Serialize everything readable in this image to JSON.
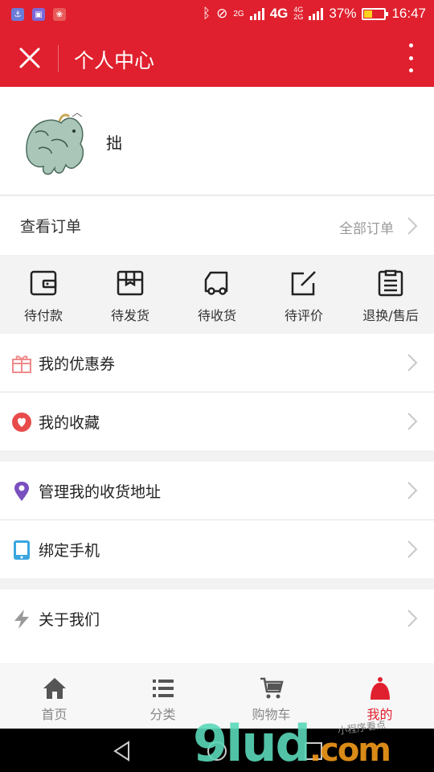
{
  "status_bar": {
    "network_top": "2G",
    "network_main": "4G",
    "network_second": "4G",
    "network_second_sub": "2G",
    "battery": "37%",
    "battery_level": 0.37,
    "time": "16:47"
  },
  "header": {
    "title": "个人中心"
  },
  "profile": {
    "username": "拙"
  },
  "orders": {
    "title": "查看订单",
    "all_label": "全部订单"
  },
  "order_status": [
    {
      "label": "待付款",
      "icon": "wallet-icon"
    },
    {
      "label": "待发货",
      "icon": "box-icon"
    },
    {
      "label": "待收货",
      "icon": "truck-icon"
    },
    {
      "label": "待评价",
      "icon": "edit-icon"
    },
    {
      "label": "退换/售后",
      "icon": "clipboard-icon"
    }
  ],
  "menu": [
    {
      "label": "我的优惠券",
      "icon": "gift-icon",
      "color": "#f08a8a"
    },
    {
      "label": "我的收藏",
      "icon": "heart-icon",
      "color": "#e84b4b"
    },
    {
      "label": "管理我的收货地址",
      "icon": "location-icon",
      "color": "#7a4fbf"
    },
    {
      "label": "绑定手机",
      "icon": "phone-icon",
      "color": "#3aa6e0"
    },
    {
      "label": "关于我们",
      "icon": "lightning-icon",
      "color": "#999999"
    }
  ],
  "tabbar": [
    {
      "label": "首页",
      "icon": "home-icon",
      "active": false
    },
    {
      "label": "分类",
      "icon": "list-icon",
      "active": false
    },
    {
      "label": "购物车",
      "icon": "cart-icon",
      "active": false
    },
    {
      "label": "我的",
      "icon": "user-icon",
      "active": true
    }
  ],
  "colors": {
    "brand": "#e0202e",
    "muted": "#999999",
    "background": "#f2f2f2"
  },
  "watermark": {
    "main": "9lud",
    "suffix": ".com",
    "tagline": "小程序看点"
  }
}
